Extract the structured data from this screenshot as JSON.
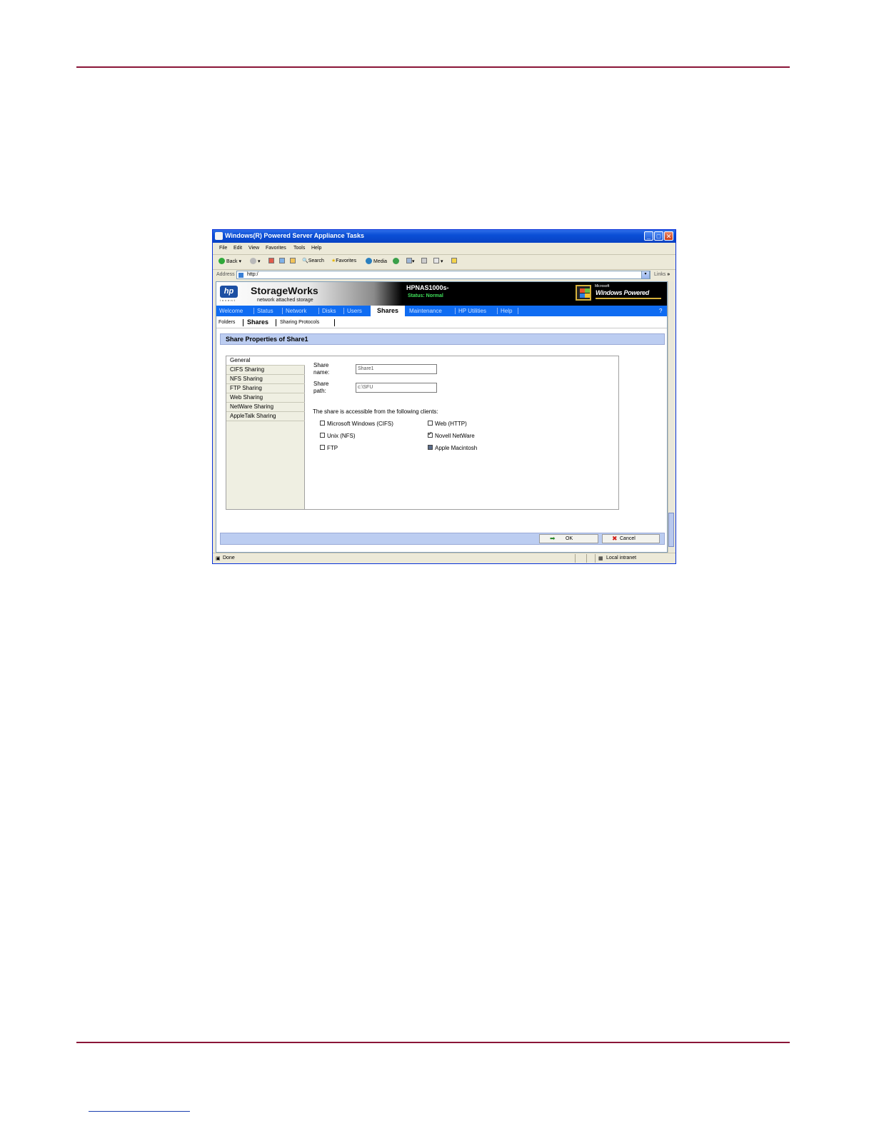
{
  "window": {
    "title": "Windows(R) Powered Server Appliance Tasks",
    "minimize": "_",
    "maximize": "□",
    "close": "✕"
  },
  "menu": [
    "File",
    "Edit",
    "View",
    "Favorites",
    "Tools",
    "Help"
  ],
  "toolbar": {
    "back": "Back",
    "search": "Search",
    "favorites": "Favorites",
    "media": "Media"
  },
  "address": {
    "label": "Address",
    "value": "http:/",
    "links": "Links",
    "more": "»"
  },
  "banner": {
    "logo": "hp",
    "invent": "invent",
    "product": "StorageWorks",
    "subtitle": "network attached storage",
    "server_name": "HPNAS1000s-",
    "status": "Status: Normal",
    "windows_ms": "Microsoft",
    "windows_powered": "Windows Powered"
  },
  "nav": {
    "items": [
      "Welcome",
      "Status",
      "Network",
      "Disks",
      "Users"
    ],
    "active": "Shares",
    "items_after": [
      "Maintenance",
      "HP Utilities",
      "Help"
    ],
    "help_icon": "?"
  },
  "subnav": {
    "folders": "Folders",
    "shares": "Shares",
    "protocols": "Sharing Protocols"
  },
  "section_title": "Share Properties of Share1",
  "tabs": [
    "General",
    "CIFS Sharing",
    "NFS Sharing",
    "FTP Sharing",
    "Web Sharing",
    "NetWare Sharing",
    "AppleTalk Sharing"
  ],
  "form": {
    "share_name_label_1": "Share",
    "share_name_label_2": "name:",
    "share_name_value": "Share1",
    "share_path_label_1": "Share",
    "share_path_label_2": "path:",
    "share_path_value": "c:\\SFU",
    "clients_heading": "The share is accessible from the following clients:",
    "clients": {
      "cifs": "Microsoft Windows (CIFS)",
      "nfs": "Unix (NFS)",
      "ftp": "FTP",
      "web": "Web (HTTP)",
      "netware": "Novell NetWare",
      "apple": "Apple Macintosh"
    }
  },
  "buttons": {
    "ok": "OK",
    "cancel": "Cancel"
  },
  "statusbar": {
    "status": "Done",
    "zone": "Local intranet"
  },
  "colors": {
    "accent_rule": "#8a1538",
    "nav_blue": "#0f6cf2",
    "section_header": "#bccdf1",
    "status_green": "#3fe05a"
  }
}
